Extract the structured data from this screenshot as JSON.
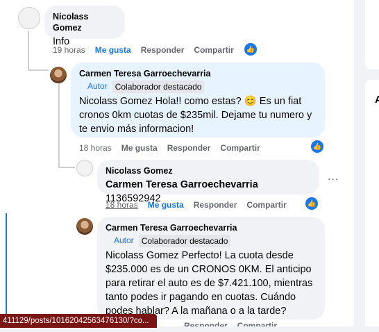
{
  "comments": [
    {
      "author": "Nicolass Gomez",
      "text": "Info",
      "time": "19 horas",
      "like": "Me gusta",
      "reply": "Responder",
      "share": "Compartir"
    },
    {
      "author": "Carmen Teresa Garroechevarria",
      "badge_author": "Autor",
      "badge_top": "Colaborador destacado",
      "text": "Nicolass Gomez Hola!! como estas? 😊 Es un fiat cronos 0km cuotas de $235mil. Dejame tu numero y te envio más informacion!",
      "time": "18 horas",
      "like": "Me gusta",
      "reply": "Responder",
      "share": "Compartir"
    },
    {
      "author": "Nicolass Gomez",
      "mention": "Carmen Teresa Garroechevarria",
      "text": "1136592942",
      "time": "18 horas",
      "like": "Me gusta",
      "reply": "Responder",
      "share": "Compartir"
    },
    {
      "author": "Carmen Teresa Garroechevarria",
      "badge_author": "Autor",
      "badge_top": "Colaborador destacado",
      "text": "Nicolass Gomez Perfecto! La cuota desde $235.000 es de un CRONOS 0KM. El anticipo para retirar el auto es de $7.421.100, mientras tanto podes ir pagando en cuotas. Cuándo podes hablar? A la mañana o a la tarde?",
      "reply": "Responder",
      "share": "Compartir"
    }
  ],
  "more_options": "...",
  "status_url": "411129/posts/10162042563476130/?co...",
  "sidebar_letter": "A",
  "colors": {
    "accent": "#1877f2",
    "bubble": "#f0f2f5",
    "bubble_selected": "#e7f3ff"
  }
}
